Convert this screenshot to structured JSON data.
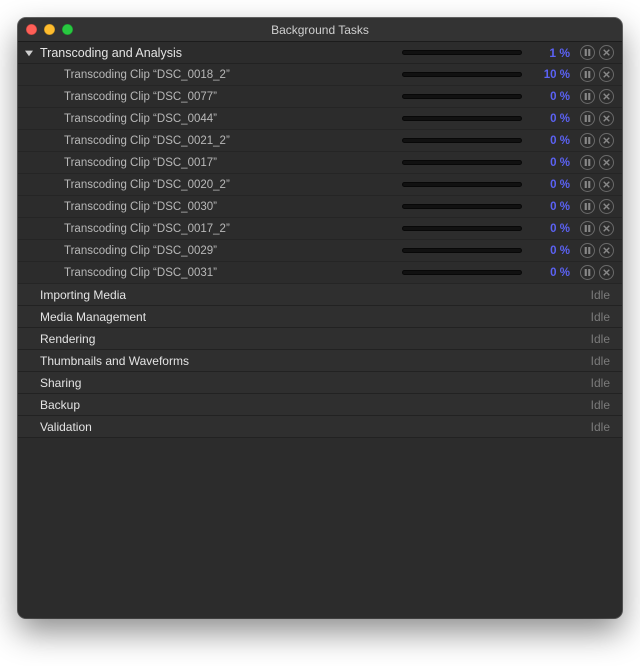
{
  "window_title": "Background Tasks",
  "header": {
    "label": "Transcoding and Analysis",
    "progress_pct": 1,
    "display_pct": "1 %"
  },
  "tasks": [
    {
      "label": "Transcoding Clip “DSC_0018_2”",
      "progress_pct": 10,
      "display_pct": "10 %"
    },
    {
      "label": "Transcoding Clip “DSC_0077”",
      "progress_pct": 0,
      "display_pct": "0 %"
    },
    {
      "label": "Transcoding Clip “DSC_0044”",
      "progress_pct": 0,
      "display_pct": "0 %"
    },
    {
      "label": "Transcoding Clip “DSC_0021_2”",
      "progress_pct": 0,
      "display_pct": "0 %"
    },
    {
      "label": "Transcoding Clip “DSC_0017”",
      "progress_pct": 0,
      "display_pct": "0 %"
    },
    {
      "label": "Transcoding Clip “DSC_0020_2”",
      "progress_pct": 0,
      "display_pct": "0 %"
    },
    {
      "label": "Transcoding Clip “DSC_0030”",
      "progress_pct": 0,
      "display_pct": "0 %"
    },
    {
      "label": "Transcoding Clip “DSC_0017_2”",
      "progress_pct": 0,
      "display_pct": "0 %"
    },
    {
      "label": "Transcoding Clip “DSC_0029”",
      "progress_pct": 0,
      "display_pct": "0 %"
    },
    {
      "label": "Transcoding Clip “DSC_0031”",
      "progress_pct": 0,
      "display_pct": "0 %"
    }
  ],
  "categories": [
    {
      "label": "Importing Media",
      "status": "Idle"
    },
    {
      "label": "Media Management",
      "status": "Idle"
    },
    {
      "label": "Rendering",
      "status": "Idle"
    },
    {
      "label": "Thumbnails and Waveforms",
      "status": "Idle"
    },
    {
      "label": "Sharing",
      "status": "Idle"
    },
    {
      "label": "Backup",
      "status": "Idle"
    },
    {
      "label": "Validation",
      "status": "Idle"
    }
  ],
  "accent_color": "#5b62f4"
}
